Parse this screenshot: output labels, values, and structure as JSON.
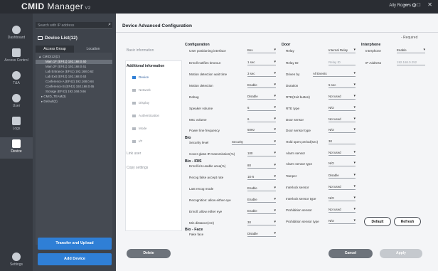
{
  "app": {
    "brand_prefix": "CMID",
    "brand_suffix": "Manager",
    "version": "V2",
    "user": "Ally Rogers",
    "window_controls": "— □ ✕"
  },
  "left_nav": [
    {
      "label": "Dashboard",
      "icon": "dashboard-icon"
    },
    {
      "label": "Access Control",
      "icon": "door-icon"
    },
    {
      "label": "T&A",
      "icon": "clock-icon"
    },
    {
      "label": "User",
      "icon": "user-icon"
    },
    {
      "label": "Logs",
      "icon": "log-icon"
    },
    {
      "label": "Device",
      "icon": "device-icon",
      "active": true
    },
    {
      "label": "Settings",
      "icon": "settings-icon"
    }
  ],
  "device_panel": {
    "search_placeholder": "Search with IP address",
    "title": "Device List(12)",
    "tabs": [
      "Access Group",
      "Location"
    ],
    "tree": [
      "▲ CMID(12)(2)",
      "Main 1F (EF41) 192.168.0.60",
      "Main 2F (EF41) 192.168.0.61",
      "Lab Entrance (EF41) 192.168.0.62",
      "Lab Exit (EF42) 192.168.0.63",
      "Conference A (EF42) 192.168.0.64",
      "Conference B (EF42) 192.168.0.65",
      "Storage (EF42) 192.168.0.66",
      "▸ CMID_TEAM(3)",
      "▸ Default(2)"
    ],
    "transfer_button": "Transfer and Upload",
    "add_button": "Add Device"
  },
  "main": {
    "title": "Device Advanced Configuration",
    "required_note": "- Required",
    "nav": {
      "basic": "Basic information",
      "additional": "Additional information",
      "sub": [
        "Device",
        "Network",
        "Display",
        "Authentication",
        "Mode",
        "I/F"
      ],
      "link_user": "Link user",
      "copy_settings": "Copy settings"
    },
    "sections": {
      "configuration": "Configuration",
      "bio": "Bio",
      "bio_iris": "Bio - IRIS",
      "bio_face": "Bio - Face",
      "door": "Door",
      "interphone": "Interphone"
    },
    "config_fields": [
      {
        "label": "User positioning interface",
        "value": "Box"
      },
      {
        "label": "Enroll notifies timeout",
        "value": "1 sec"
      },
      {
        "label": "Motion detection wait time",
        "value": "3 sec"
      },
      {
        "label": "Motion detection",
        "value": "Enable"
      },
      {
        "label": "Debug",
        "value": "Disable"
      },
      {
        "label": "Speaker volume",
        "value": "6"
      },
      {
        "label": "MIC volume",
        "value": "6"
      },
      {
        "label": "Power line frequency",
        "value": "60Hz"
      }
    ],
    "bio_fields": [
      {
        "label": "Security level",
        "value": "Security"
      },
      {
        "label": "Cover glass IR transmission(%)",
        "value": "100"
      }
    ],
    "iris_fields": [
      {
        "label": "Enroll iris usable area(%)",
        "value": "80"
      },
      {
        "label": "Recog false accept rate",
        "value": "1E-5"
      },
      {
        "label": "Last recog mode",
        "value": "Enable"
      },
      {
        "label": "Recognition: allow either eye",
        "value": "Enable"
      },
      {
        "label": "Enroll: allow either eye",
        "value": "Enable"
      },
      {
        "label": "Min distance(cm)",
        "value": "30"
      }
    ],
    "face_fields": [
      {
        "label": "Fake face",
        "value": "Disable"
      }
    ],
    "door_fields": [
      {
        "label": "Relay",
        "value": "Internal Relay"
      },
      {
        "label": "Relay ID",
        "value": "Relay ID"
      },
      {
        "label": "Driven by",
        "value": "All Events"
      },
      {
        "label": "Duration",
        "value": "5 sec"
      },
      {
        "label": "RTE(Exit button)",
        "value": "Not used"
      },
      {
        "label": "RTE type",
        "value": "N/O"
      },
      {
        "label": "Door sensor",
        "value": "Not used"
      },
      {
        "label": "Door sensor type",
        "value": "N/O"
      },
      {
        "label": "Hold open period(sec)",
        "value": "30"
      },
      {
        "label": "Alarm sensor",
        "value": "Not used"
      },
      {
        "label": "Alarm sensor type",
        "value": "N/O"
      },
      {
        "label": "Tamper",
        "value": "Disable"
      },
      {
        "label": "Interlock sensor",
        "value": "Not used"
      },
      {
        "label": "Interlock sensor type",
        "value": "N/O"
      },
      {
        "label": "Prohibition sensor",
        "value": "Not used"
      },
      {
        "label": "Prohibition sensor type",
        "value": "N/O"
      }
    ],
    "interphone_fields": [
      {
        "label": "Interphone",
        "value": "Enable"
      },
      {
        "label": "IP Address",
        "value": "192.168.0.252"
      }
    ],
    "buttons": {
      "default": "Default",
      "refresh": "Refresh",
      "delete": "Delete",
      "cancel": "Cancel",
      "apply": "Apply"
    }
  },
  "colors": {
    "primary_blue": "#2f7fd6",
    "sidebar": "#34383f",
    "panel": "#3e434b"
  }
}
